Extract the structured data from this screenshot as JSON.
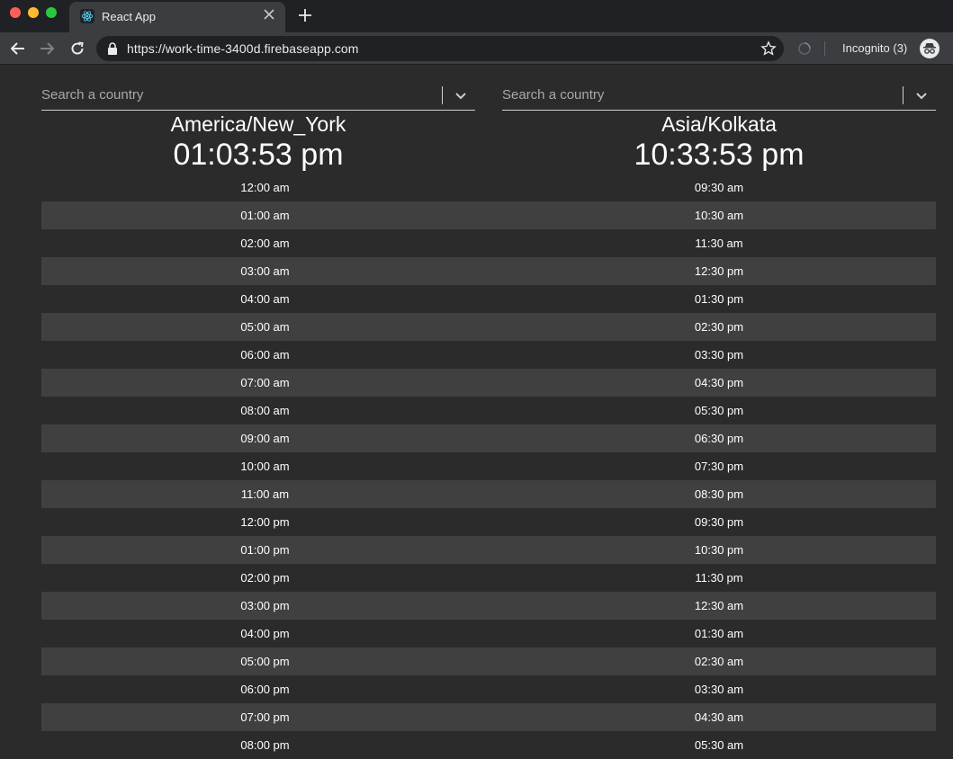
{
  "browser": {
    "tab_title": "React App",
    "url": "https://work-time-3400d.firebaseapp.com",
    "incognito_label": "Incognito (3)",
    "icons": {
      "back": "arrow-left-icon",
      "forward": "arrow-right-icon",
      "reload": "reload-icon",
      "lock": "lock-icon",
      "star": "star-icon",
      "incognito": "incognito-icon"
    }
  },
  "selectors": [
    {
      "placeholder": "Search a country",
      "zone": "America/New_York",
      "current_time": "01:03:53 pm"
    },
    {
      "placeholder": "Search a country",
      "zone": "Asia/Kolkata",
      "current_time": "10:33:53 pm"
    }
  ],
  "hours": [
    {
      "left": "12:00 am",
      "right": "09:30 am"
    },
    {
      "left": "01:00 am",
      "right": "10:30 am"
    },
    {
      "left": "02:00 am",
      "right": "11:30 am"
    },
    {
      "left": "03:00 am",
      "right": "12:30 pm"
    },
    {
      "left": "04:00 am",
      "right": "01:30 pm"
    },
    {
      "left": "05:00 am",
      "right": "02:30 pm"
    },
    {
      "left": "06:00 am",
      "right": "03:30 pm"
    },
    {
      "left": "07:00 am",
      "right": "04:30 pm"
    },
    {
      "left": "08:00 am",
      "right": "05:30 pm"
    },
    {
      "left": "09:00 am",
      "right": "06:30 pm"
    },
    {
      "left": "10:00 am",
      "right": "07:30 pm"
    },
    {
      "left": "11:00 am",
      "right": "08:30 pm"
    },
    {
      "left": "12:00 pm",
      "right": "09:30 pm"
    },
    {
      "left": "01:00 pm",
      "right": "10:30 pm"
    },
    {
      "left": "02:00 pm",
      "right": "11:30 pm"
    },
    {
      "left": "03:00 pm",
      "right": "12:30 am"
    },
    {
      "left": "04:00 pm",
      "right": "01:30 am"
    },
    {
      "left": "05:00 pm",
      "right": "02:30 am"
    },
    {
      "left": "06:00 pm",
      "right": "03:30 am"
    },
    {
      "left": "07:00 pm",
      "right": "04:30 am"
    },
    {
      "left": "08:00 pm",
      "right": "05:30 am"
    }
  ],
  "colors": {
    "background": "#2b2b2b",
    "row_alt": "#404040",
    "chrome_dark": "#202124",
    "chrome_toolbar": "#3c3d41"
  }
}
